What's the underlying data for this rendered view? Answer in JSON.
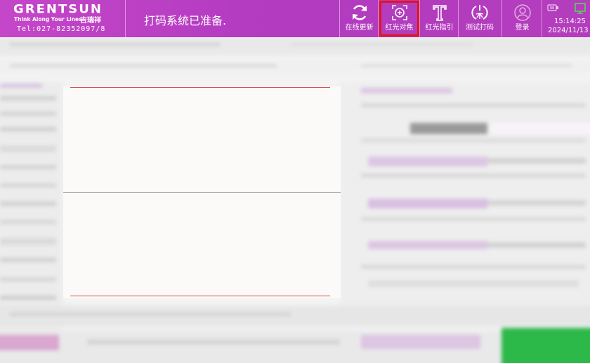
{
  "header": {
    "logo": {
      "brand": "GRENTSUN",
      "slogan": "Think Along Your Lines",
      "brand_cn": "吉瑞祥",
      "tel": "Tel:027-82352097/8"
    },
    "status_message": "打码系统已准备.",
    "toolbar": [
      {
        "label": "在线更新",
        "icon": "refresh-icon"
      },
      {
        "label": "红光对焦",
        "icon": "focus-target-icon",
        "active": true
      },
      {
        "label": "红光指引",
        "icon": "text-t-icon"
      },
      {
        "label": "测试打码",
        "icon": "laser-test-icon"
      },
      {
        "label": "登录",
        "icon": "user-icon"
      }
    ],
    "system": {
      "time": "15:14:25",
      "date": "2024/11/13",
      "usb_icon": "usb-icon",
      "network_icon": "network-icon"
    }
  },
  "colors": {
    "header_bg": "#b83dc0",
    "active_highlight": "#e4141b",
    "accent_green": "#2db84a"
  }
}
